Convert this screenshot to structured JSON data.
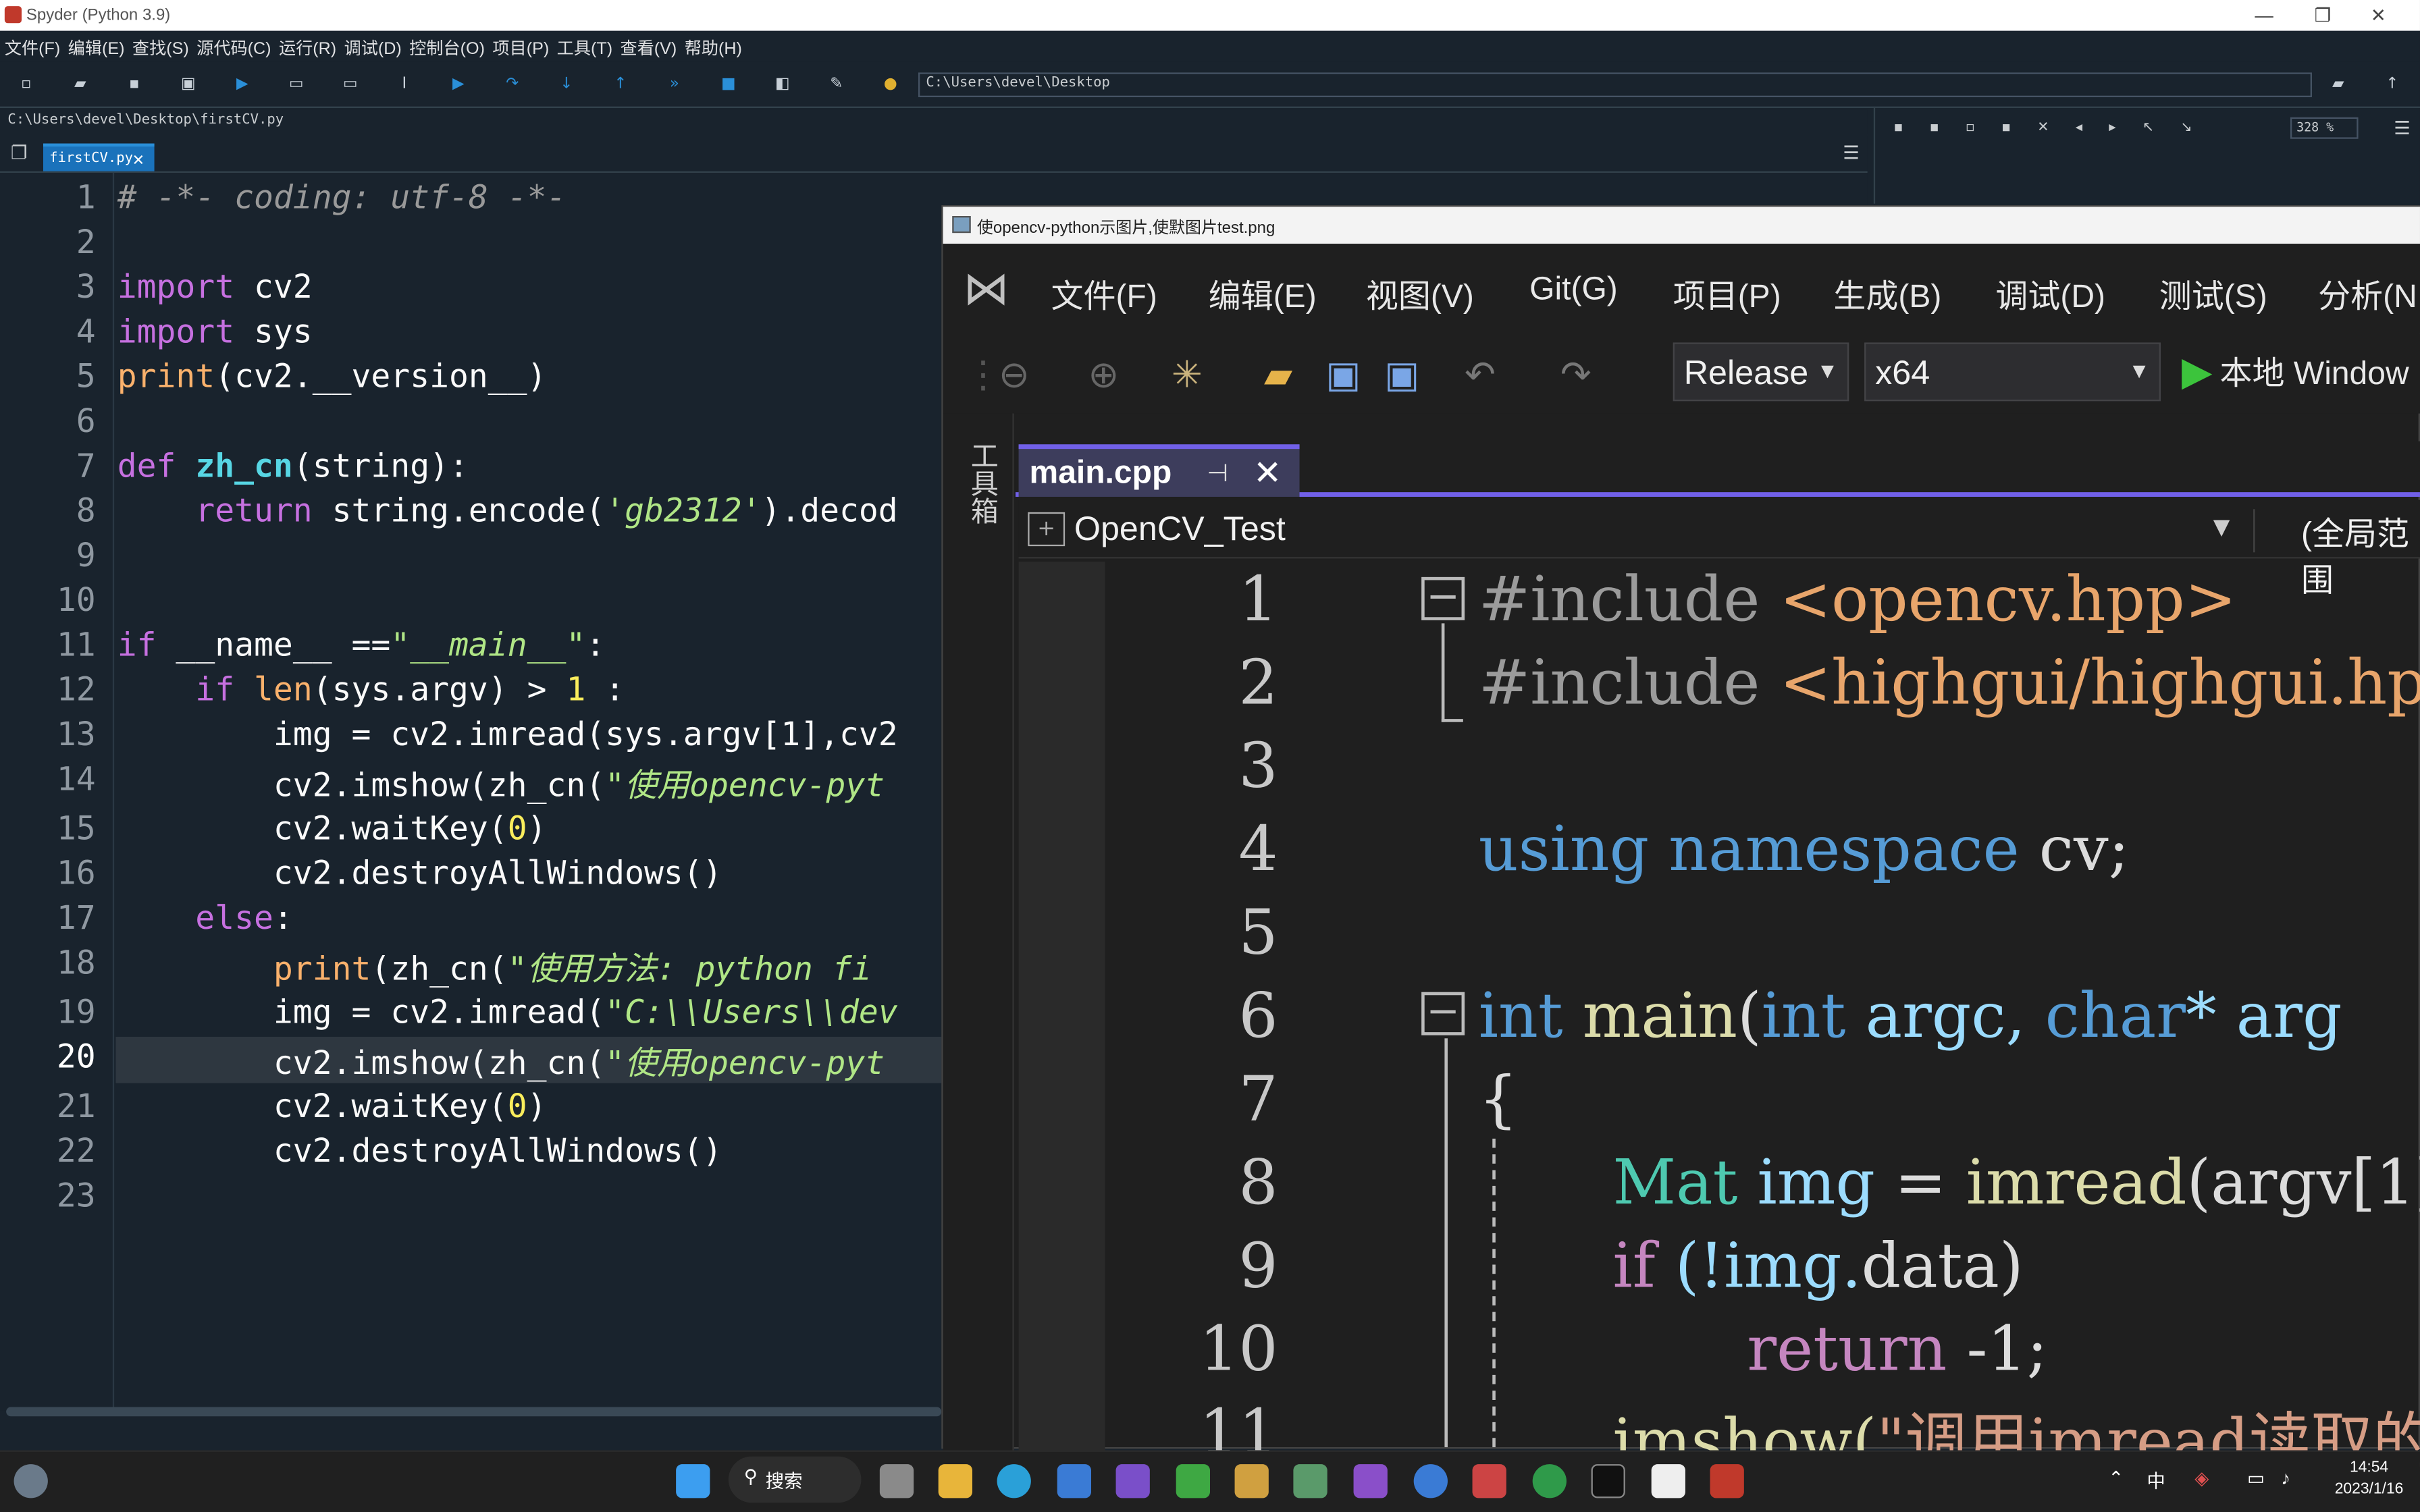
{
  "spyder": {
    "window_title": "Spyder (Python 3.9)",
    "menu": [
      "文件(F)",
      "编辑(E)",
      "查找(S)",
      "源代码(C)",
      "运行(R)",
      "调试(D)",
      "控制台(O)",
      "项目(P)",
      "工具(T)",
      "查看(V)",
      "帮助(H)"
    ],
    "working_dir": "C:\\Users\\devel\\Desktop",
    "file_path": "C:\\Users\\devel\\Desktop\\firstCV.py",
    "tab_label": "firstCV.py",
    "zoom": "328 %",
    "current_line": "20",
    "lines": [
      {
        "n": "1"
      },
      {
        "n": "2"
      },
      {
        "n": "3"
      },
      {
        "n": "4"
      },
      {
        "n": "5"
      },
      {
        "n": "6"
      },
      {
        "n": "7"
      },
      {
        "n": "8"
      },
      {
        "n": "9"
      },
      {
        "n": "10"
      },
      {
        "n": "11"
      },
      {
        "n": "12"
      },
      {
        "n": "13"
      },
      {
        "n": "14"
      },
      {
        "n": "15"
      },
      {
        "n": "16"
      },
      {
        "n": "17"
      },
      {
        "n": "18"
      },
      {
        "n": "19"
      },
      {
        "n": "20"
      },
      {
        "n": "21"
      },
      {
        "n": "22"
      },
      {
        "n": "23"
      }
    ],
    "code": {
      "l1": "# -*- coding: utf-8 -*-",
      "l3a": "import",
      "l3b": " cv2",
      "l4a": "import",
      "l4b": " sys",
      "l5a": "print",
      "l5b": "(cv2.__version__)",
      "l7a": "def ",
      "l7b": "zh_cn",
      "l7c": "(string):",
      "l8a": "    return",
      "l8b": " string.encode(",
      "l8c": "'gb2312'",
      "l8d": ").decod",
      "l11a": "if",
      "l11b": " __name__ ==",
      "l11c": "\"__main__\"",
      "l11d": ":",
      "l12a": "    if ",
      "l12b": "len",
      "l12c": "(sys.argv) > ",
      "l12d": "1",
      "l12e": " :",
      "l13": "        img = cv2.imread(sys.argv[1],cv2",
      "l14a": "        cv2.imshow(zh_cn(",
      "l14b": "\"使用opencv-pyt",
      "l15a": "        cv2.waitKey(",
      "l15b": "0",
      "l15c": ")",
      "l16": "        cv2.destroyAllWindows()",
      "l17a": "    else",
      "l17b": ":",
      "l18a": "        ",
      "l18b": "print",
      "l18c": "(zh_cn(",
      "l18d": "\"使用方法: python fi",
      "l19a": "        img = cv2.imread(",
      "l19b": "\"C:\\\\Users\\\\dev",
      "l20a": "        cv2.imshow(zh_cn(",
      "l20b": "\"使用opencv-pyt",
      "l21a": "        cv2.waitKey(",
      "l21b": "0",
      "l21c": ")",
      "l22": "        cv2.destroyAllWindows()"
    }
  },
  "vs": {
    "window_title": "使opencv-python示图片,使默图片test.png",
    "menu": [
      "文件(F)",
      "编辑(E)",
      "视图(V)",
      "Git(G)",
      "项目(P)",
      "生成(B)",
      "调试(D)",
      "测试(S)",
      "分析(N"
    ],
    "config": "Release",
    "platform": "x64",
    "run_label": "本地 Window",
    "toolbox": "工具箱",
    "tab_label": "main.cpp",
    "project": "OpenCV_Test",
    "scope": "(全局范围",
    "line_numbers": [
      "1",
      "2",
      "3",
      "4",
      "5",
      "6",
      "7",
      "8",
      "9",
      "10",
      "11"
    ],
    "code": {
      "l1a": "#include ",
      "l1b": "<opencv.hpp>",
      "l2a": "#include ",
      "l2b": "<highgui/highgui.hp",
      "l4a": "using namespace ",
      "l4b": "cv;",
      "l6a": "int ",
      "l6b": "main",
      "l6c": "(",
      "l6d": "int ",
      "l6e": "argc, ",
      "l6f": "char",
      "l6g": "* arg",
      "l7": "{",
      "l8a": "Mat ",
      "l8b": "img ",
      "l8c": "= ",
      "l8d": "imread",
      "l8e": "(argv[1]",
      "l9a": "if ",
      "l9b": "(!img.",
      "l9c": "data)",
      "l10a": "return ",
      "l10b": "-1;",
      "l11a": "imshow(",
      "l11b": "\"调用imread读取的"
    }
  },
  "taskbar": {
    "search_label": "搜索",
    "ime": "中",
    "time": "14:54",
    "date": "2023/1/16"
  }
}
